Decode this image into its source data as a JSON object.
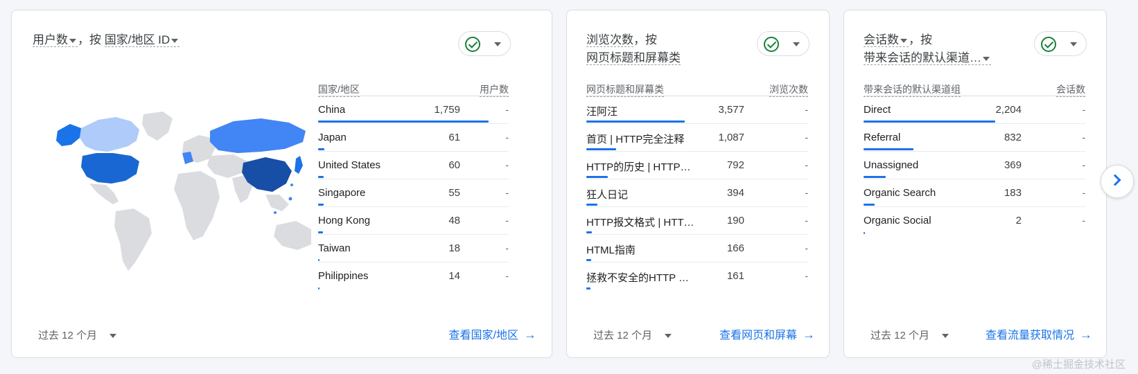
{
  "colors": {
    "accent": "#1a73e8",
    "success": "#188038"
  },
  "card_country": {
    "title_metric": "用户数",
    "title_sep": "，按",
    "title_dim": "国家/地区 ID",
    "col_dim": "国家/地区",
    "col_metric": "用户数",
    "rows": [
      {
        "name": "China",
        "value": "1,759",
        "dash": "-",
        "share": 1.0
      },
      {
        "name": "Japan",
        "value": "61",
        "dash": "-",
        "share": 0.035
      },
      {
        "name": "United States",
        "value": "60",
        "dash": "-",
        "share": 0.034
      },
      {
        "name": "Singapore",
        "value": "55",
        "dash": "-",
        "share": 0.031
      },
      {
        "name": "Hong Kong",
        "value": "48",
        "dash": "-",
        "share": 0.027
      },
      {
        "name": "Taiwan",
        "value": "18",
        "dash": "-",
        "share": 0.01
      },
      {
        "name": "Philippines",
        "value": "14",
        "dash": "-",
        "share": 0.008
      }
    ],
    "date_range": "过去 12 个月",
    "link": "查看国家/地区",
    "map_icon": "world-map-icon"
  },
  "card_pages": {
    "title_metric": "浏览次数",
    "title_sep": "，按",
    "title_dim": "网页标题和屏幕类",
    "col_dim": "网页标题和屏幕类",
    "col_metric": "浏览次数",
    "rows": [
      {
        "name": "汪阿汪",
        "value": "3,577",
        "dash": "-",
        "share": 1.0
      },
      {
        "name": "首页 | HTTP完全注释",
        "value": "1,087",
        "dash": "-",
        "share": 0.304
      },
      {
        "name": "HTTP的历史 | HTTP…",
        "value": "792",
        "dash": "-",
        "share": 0.221
      },
      {
        "name": "狂人日记",
        "value": "394",
        "dash": "-",
        "share": 0.11
      },
      {
        "name": "HTTP报文格式 | HTT…",
        "value": "190",
        "dash": "-",
        "share": 0.053
      },
      {
        "name": "HTML指南",
        "value": "166",
        "dash": "-",
        "share": 0.046
      },
      {
        "name": "拯救不安全的HTTP …",
        "value": "161",
        "dash": "-",
        "share": 0.045
      }
    ],
    "date_range": "过去 12 个月",
    "link": "查看网页和屏幕"
  },
  "card_channels": {
    "title_metric": "会话数",
    "title_sep": "，按",
    "title_dim": "带来会话的默认渠道…",
    "col_dim": "带来会话的默认渠道组",
    "col_metric": "会话数",
    "rows": [
      {
        "name": "Direct",
        "value": "2,204",
        "dash": "-",
        "share": 1.0
      },
      {
        "name": "Referral",
        "value": "832",
        "dash": "-",
        "share": 0.377
      },
      {
        "name": "Unassigned",
        "value": "369",
        "dash": "-",
        "share": 0.167
      },
      {
        "name": "Organic Search",
        "value": "183",
        "dash": "-",
        "share": 0.083
      },
      {
        "name": "Organic Social",
        "value": "2",
        "dash": "-",
        "share": 0.004
      }
    ],
    "date_range": "过去 12 个月",
    "link": "查看流量获取情况"
  },
  "watermark": "@稀土掘金技术社区"
}
